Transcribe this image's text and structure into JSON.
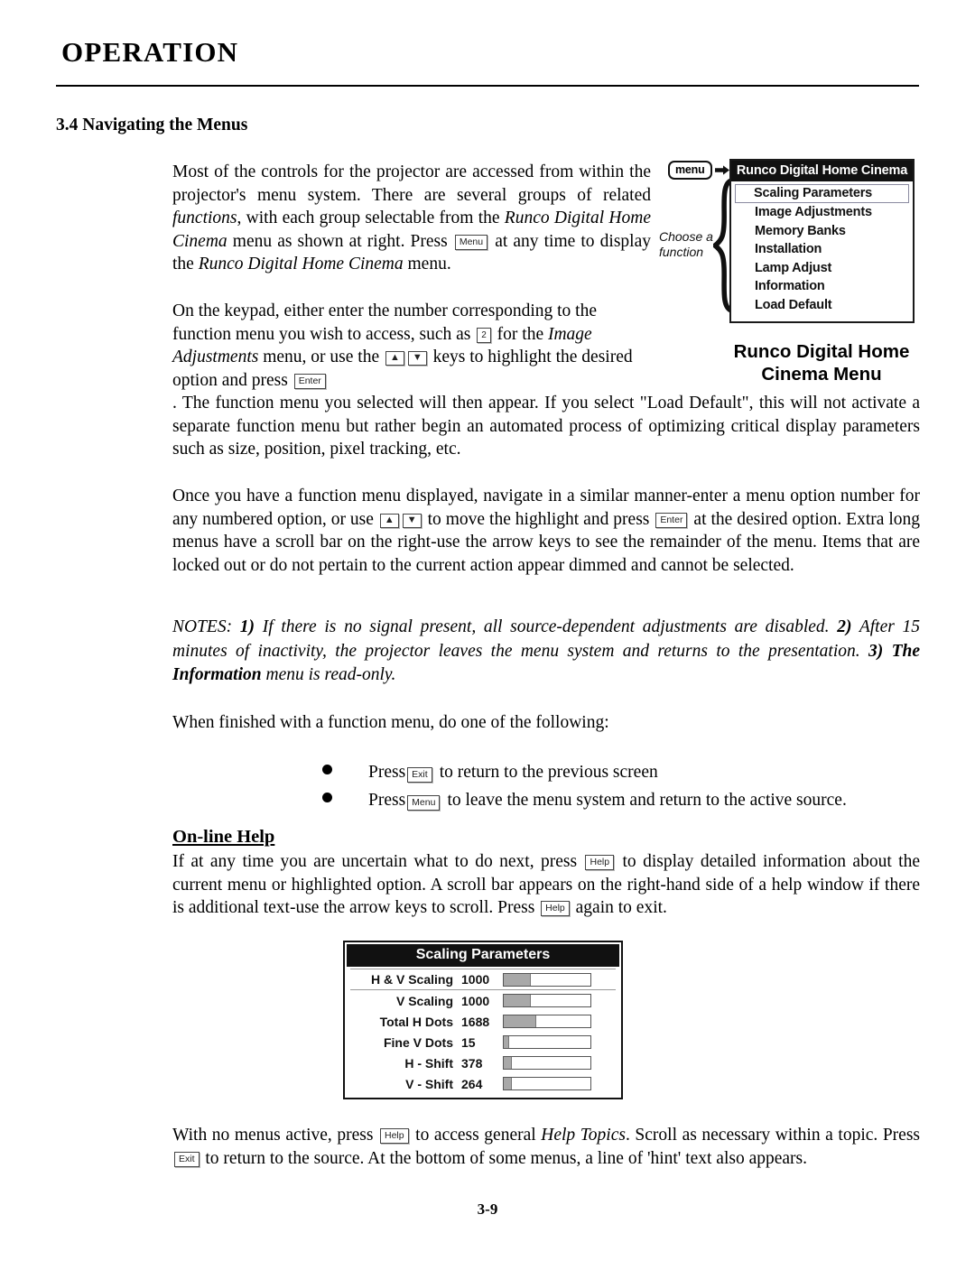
{
  "header": {
    "chapter_title": "OPERATION"
  },
  "section": {
    "number_title": "3.4 Navigating the Menus"
  },
  "paragraphs": {
    "p1_a": "Most of the controls for the projector are accessed from within the projector's menu system. There are several groups of related ",
    "p1_functions": "functions",
    "p1_b": ", with each group selectable from the ",
    "p1_runco": "Runco Digital Home Cinema",
    "p1_c": " menu as shown at right. Press ",
    "p1_key_menu": "Menu",
    "p1_d": " at any time to display the ",
    "p1_runco2": "Runco Digital Home Cinema",
    "p1_e": " menu.",
    "p2_a": "On the keypad, either enter the number corresponding to the function menu you wish to access, such as ",
    "p2_key_2": "2",
    "p2_b": " for the ",
    "p2_image_adj": "Image Adjustments",
    "p2_c": " menu, or use the ",
    "p2_key_up": "▲",
    "p2_key_down": "▼",
    "p2_d": " keys to highlight the desired option and press ",
    "p2_key_enter": "Enter",
    "p2_e": " . The function menu you selected will then appear. If you select \"Load Default\", this will not activate a separate function menu but rather begin an automated process of optimizing critical display parameters such as size, position, pixel tracking, etc.",
    "p3_a": "Once you have a function menu displayed, navigate in a similar manner-enter a menu option number for any numbered option, or use ",
    "p3_key_up": "▲",
    "p3_key_down": "▼",
    "p3_b": " to move the highlight and press ",
    "p3_key_enter": "Enter",
    "p3_c": " at the desired option. Extra long menus have a scroll bar on the right-use the arrow keys to see the remainder of the menu. Items that are locked out or do not pertain to the current action appear dimmed and cannot be selected.",
    "notes_a": "NOTES: ",
    "notes_1": "1)",
    "notes_b": " If there is no signal present, all source-dependent adjustments are disabled. ",
    "notes_2": "2)",
    "notes_c": " After 15 minutes of inactivity, the projector leaves the menu system and returns to the presentation. ",
    "notes_3": "3) The Information",
    "notes_d": " menu is read-only.",
    "p4": "When finished with a function menu, do one of the following:",
    "p5_a": "If at any time you are uncertain what to do next, press ",
    "p5_key_help": "Help",
    "p5_b": " to display detailed information about the current menu or highlighted option. A scroll bar appears on the right-hand side of a help window if there is additional text-use the arrow keys to scroll. Press ",
    "p5_key_help2": "Help",
    "p5_c": " again to exit.",
    "p6_a": "With no menus active, press ",
    "p6_key_help": "Help",
    "p6_b": " to access general ",
    "p6_help_topics": "Help Topics",
    "p6_c": ". Scroll as necessary within a topic. Press ",
    "p6_key_exit": "Exit",
    "p6_d": " to return to the source. At the bottom of some menus, a line of 'hint' text also appears."
  },
  "bullets": [
    {
      "press": "Press",
      "key": "Exit",
      "text": "to return to the previous screen"
    },
    {
      "press": "Press",
      "key": "Menu",
      "text": "to leave the menu system and return to the active source."
    }
  ],
  "subheads": {
    "online_help": "On-line Help"
  },
  "osd_menu": {
    "remote_button": "menu",
    "brace_label_line1": "Choose a",
    "brace_label_line2": "function",
    "title": "Runco Digital Home Cinema",
    "items": [
      {
        "label": "Scaling Parameters",
        "selected": true
      },
      {
        "label": "Image Adjustments",
        "selected": false
      },
      {
        "label": "Memory Banks",
        "selected": false
      },
      {
        "label": "Installation",
        "selected": false
      },
      {
        "label": "Lamp Adjust",
        "selected": false
      },
      {
        "label": "Information",
        "selected": false
      },
      {
        "label": "Load Default",
        "selected": false
      }
    ],
    "caption_line1": "Runco Digital Home",
    "caption_line2": "Cinema Menu"
  },
  "scaling_panel": {
    "title": "Scaling Parameters",
    "rows": [
      {
        "label": "H & V Scaling",
        "value": "1000",
        "fill_pct": 31
      },
      {
        "label": "V Scaling",
        "value": "1000",
        "fill_pct": 31
      },
      {
        "label": "Total H Dots",
        "value": "1688",
        "fill_pct": 38
      },
      {
        "label": "Fine V Dots",
        "value": "15",
        "fill_pct": 6
      },
      {
        "label": "H - Shift",
        "value": "378",
        "fill_pct": 9
      },
      {
        "label": "V - Shift",
        "value": "264",
        "fill_pct": 9
      }
    ]
  },
  "footer": {
    "page_number": "3-9"
  },
  "colors": {
    "osd_title_bg": "#111111",
    "osd_title_fg": "#ffffff",
    "bar_fill": "#a8a8a8",
    "selection_border": "#8a8aa0"
  }
}
